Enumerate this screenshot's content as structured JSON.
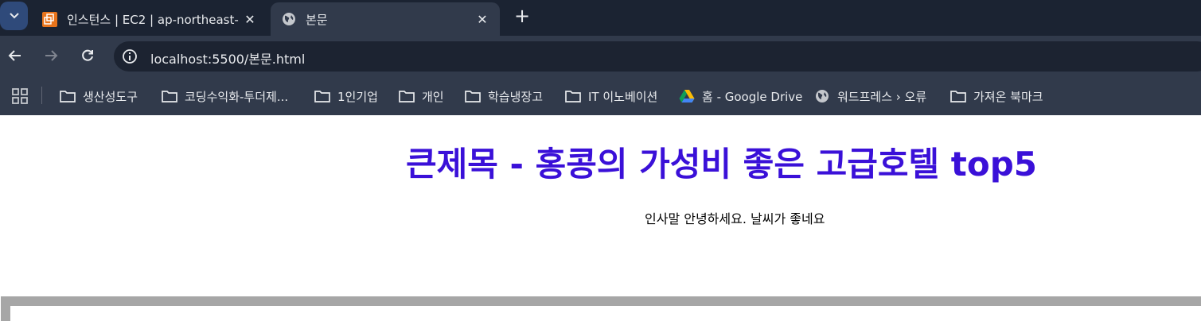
{
  "tabs": [
    {
      "title": "인스턴스 | EC2 | ap-northeast-",
      "active": false,
      "icon": "aws-ec2-icon"
    },
    {
      "title": "본문",
      "active": true,
      "icon": "globe-icon"
    }
  ],
  "toolbar": {
    "url": "localhost:5500/본문.html"
  },
  "bookmarks": [
    {
      "label": "생산성도구",
      "icon": "folder-icon"
    },
    {
      "label": "코딩수익화-투더제...",
      "icon": "folder-icon"
    },
    {
      "label": "1인기업",
      "icon": "folder-icon"
    },
    {
      "label": "개인",
      "icon": "folder-icon"
    },
    {
      "label": "학습냉장고",
      "icon": "folder-icon"
    },
    {
      "label": "IT 이노베이션",
      "icon": "folder-icon"
    },
    {
      "label": "홈 - Google Drive",
      "icon": "google-drive-icon"
    },
    {
      "label": "워드프레스 › 오류",
      "icon": "globe-icon"
    },
    {
      "label": "가져온 북마크",
      "icon": "folder-icon"
    }
  ],
  "page": {
    "heading": "큰제목 - 홍콩의 가성비 좋은 고급호텔 top5",
    "greeting": "인사말 안녕하세요. 날씨가 좋네요",
    "heading_color": "#3a10d8"
  },
  "colors": {
    "tabstrip": "#1b2332",
    "toolbar": "#313a4b",
    "omnibox": "#1c2331",
    "frame_border": "#a6a6a6"
  }
}
